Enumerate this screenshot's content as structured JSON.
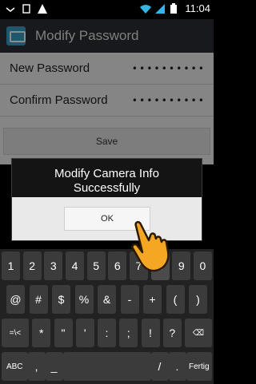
{
  "status_bar": {
    "time": "11:04",
    "left_icons": [
      "usb-icon",
      "sdcard-icon",
      "warning-icon"
    ],
    "right_icons": [
      "wifi-icon",
      "signal-icon",
      "battery-icon"
    ]
  },
  "action_bar": {
    "title": "Modify Password",
    "icon": "app-camera-icon"
  },
  "form": {
    "new_password_label": "New Password",
    "new_password_value": "••••••••••",
    "confirm_password_label": "Confirm Password",
    "confirm_password_value": "••••••••••",
    "save_label": "Save"
  },
  "dialog": {
    "message_line1": "Modify Camera Info",
    "message_line2": "Successfully",
    "ok_label": "OK"
  },
  "keyboard": {
    "row1": [
      "1",
      "2",
      "3",
      "4",
      "5",
      "6",
      "7",
      "8",
      "9",
      "0"
    ],
    "row2": [
      "@",
      "#",
      "$",
      "%",
      "&",
      "-",
      "+",
      "(",
      ")"
    ],
    "row3": [
      "=\\<",
      "*",
      "\"",
      "'",
      ":",
      ";",
      "!",
      "?",
      "⌫"
    ],
    "row4_left": "ABC",
    "row4_comma": ",",
    "row4_underscore": "_",
    "row4_slash": "/",
    "row4_dot": ".",
    "row4_enter": "Fertig"
  },
  "colors": {
    "accent": "#f5a623",
    "dialog_bg": "#141414",
    "action_bar_bg": "#2a2f33"
  }
}
